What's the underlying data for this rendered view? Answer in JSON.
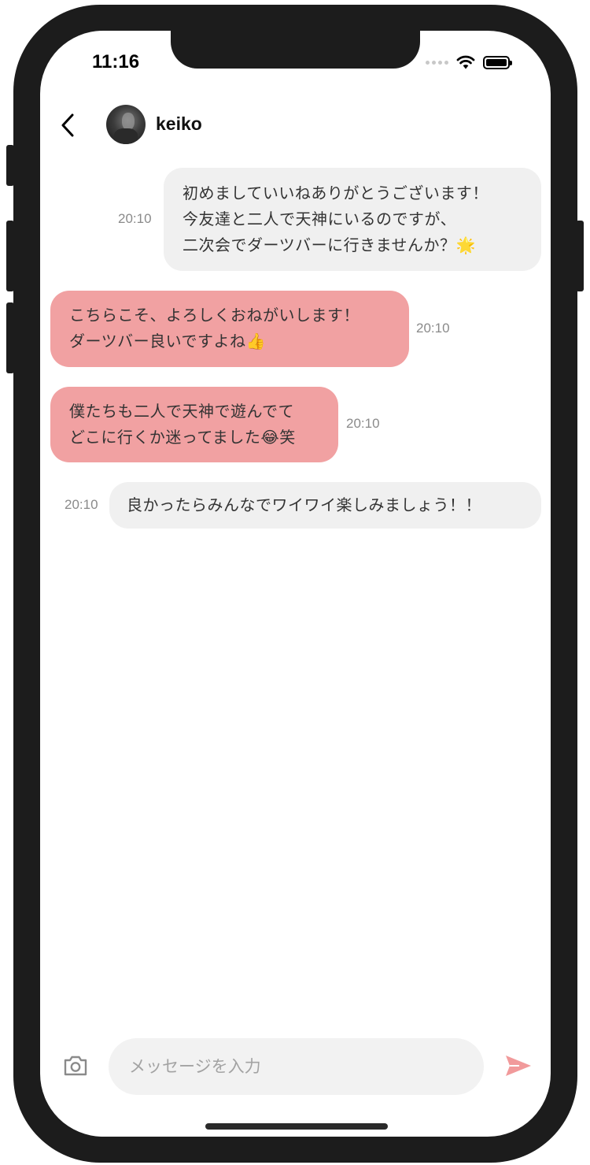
{
  "status_bar": {
    "time": "11:16"
  },
  "header": {
    "username": "keiko"
  },
  "messages": [
    {
      "direction": "incoming",
      "lines": [
        "初めましていいねありがとうございます！",
        "今友達と二人で天神にいるのですが、",
        "二次会でダーツバーに行きませんか？🌟"
      ],
      "time": "20:10"
    },
    {
      "direction": "outgoing",
      "lines": [
        "こちらこそ、よろしくおねがいします！",
        "ダーツバー良いですよね👍"
      ],
      "time": "20:10"
    },
    {
      "direction": "outgoing",
      "lines": [
        "僕たちも二人で天神で遊んでて",
        "どこに行くか迷ってました😂笑"
      ],
      "time": "20:10"
    },
    {
      "direction": "incoming",
      "lines": [
        "良かったらみんなでワイワイ楽しみましょう！！"
      ],
      "time": "20:10"
    }
  ],
  "composer": {
    "placeholder": "メッセージを入力",
    "value": ""
  },
  "icons": {
    "back": "chevron-left-icon",
    "camera": "camera-icon",
    "send": "send-icon"
  },
  "colors": {
    "outgoing_bubble": "#f1a1a2",
    "incoming_bubble": "#f0f0f0",
    "send_icon": "#f19a9b"
  }
}
